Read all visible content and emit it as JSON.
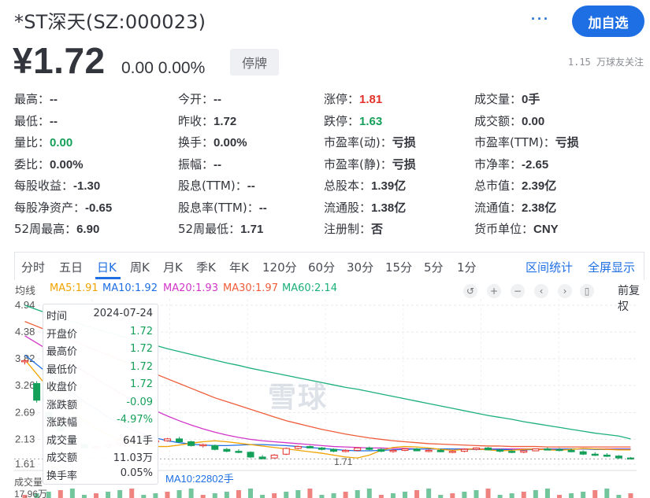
{
  "header": {
    "title": "*ST深天(SZ:000023)",
    "more_label": "···",
    "add_button": "加自选",
    "price": "¥1.72",
    "change": "0.00  0.00%",
    "status_badge": "停牌",
    "followers": "1.15 万球友关注"
  },
  "quote": {
    "rows": [
      [
        {
          "label": "最高：",
          "value": "--"
        },
        {
          "label": "今开：",
          "value": "--"
        },
        {
          "label": "涨停：",
          "value": "1.81",
          "color": "red"
        },
        {
          "label": "成交量：",
          "value": "0手"
        }
      ],
      [
        {
          "label": "最低：",
          "value": "--"
        },
        {
          "label": "昨收：",
          "value": "1.72"
        },
        {
          "label": "跌停：",
          "value": "1.63",
          "color": "green"
        },
        {
          "label": "成交额：",
          "value": "0.00"
        }
      ],
      [
        {
          "label": "量比：",
          "value": "0.00",
          "color": "green"
        },
        {
          "label": "换手：",
          "value": "0.00%"
        },
        {
          "label": "市盈率(动)：",
          "value": "亏损"
        },
        {
          "label": "市盈率(TTM)：",
          "value": "亏损"
        }
      ],
      [
        {
          "label": "委比：",
          "value": "0.00%"
        },
        {
          "label": "振幅：",
          "value": "--"
        },
        {
          "label": "市盈率(静)：",
          "value": "亏损"
        },
        {
          "label": "市净率：",
          "value": "-2.65"
        }
      ],
      [
        {
          "label": "每股收益：",
          "value": "-1.30"
        },
        {
          "label": "股息(TTM)：",
          "value": "--"
        },
        {
          "label": "总股本：",
          "value": "1.39亿"
        },
        {
          "label": "总市值：",
          "value": "2.39亿"
        }
      ],
      [
        {
          "label": "每股净资产：",
          "value": "-0.65"
        },
        {
          "label": "股息率(TTM)：",
          "value": "--"
        },
        {
          "label": "流通股：",
          "value": "1.38亿"
        },
        {
          "label": "流通值：",
          "value": "2.38亿"
        }
      ],
      [
        {
          "label": "52周最高：",
          "value": "6.90"
        },
        {
          "label": "52周最低：",
          "value": "1.71"
        },
        {
          "label": "注册制：",
          "value": "否"
        },
        {
          "label": "货币单位：",
          "value": "CNY"
        }
      ]
    ]
  },
  "tabs": {
    "items": [
      "分时",
      "五日",
      "日K",
      "周K",
      "月K",
      "季K",
      "年K",
      "120分",
      "60分",
      "30分",
      "15分",
      "5分",
      "1分"
    ],
    "active": "日K",
    "range_stats": "区间统计",
    "fullscreen": "全屏显示"
  },
  "ma_bar": {
    "label": "均线",
    "ma5": "MA5:1.91",
    "ma10": "MA10:1.92",
    "ma20": "MA20:1.93",
    "ma30": "MA30:1.97",
    "ma60": "MA60:2.14",
    "adjust": "前复权",
    "colors": {
      "ma5": "#f0a300",
      "ma10": "#1e6fe3",
      "ma20": "#d236c8",
      "ma30": "#ef5d3a",
      "ma60": "#1bb07a"
    }
  },
  "chart_data": {
    "type": "candlestick",
    "y_ticks": [
      "4.94",
      "4.38",
      "3.82",
      "3.26",
      "2.69",
      "2.13",
      "1.61"
    ],
    "ylim": [
      1.61,
      4.94
    ],
    "min_marker": "1.71",
    "ma60": [
      4.94,
      4.85,
      4.76,
      4.68,
      4.6,
      4.52,
      4.44,
      4.37,
      4.3,
      4.23,
      4.16,
      4.1,
      4.03,
      3.97,
      3.91,
      3.85,
      3.79,
      3.73,
      3.68,
      3.62,
      3.57,
      3.52,
      3.47,
      3.42,
      3.37,
      3.32,
      3.27,
      3.22,
      3.18,
      3.13,
      3.08,
      3.03,
      2.98,
      2.93,
      2.88,
      2.83,
      2.78,
      2.73,
      2.68,
      2.63,
      2.59,
      2.55,
      2.5,
      2.46,
      2.42,
      2.38,
      2.34,
      2.3,
      2.26,
      2.23,
      2.2,
      2.14
    ],
    "ma30": [
      4.6,
      4.5,
      4.4,
      4.3,
      4.2,
      4.1,
      4.0,
      3.9,
      3.8,
      3.7,
      3.6,
      3.5,
      3.4,
      3.3,
      3.2,
      3.1,
      3.0,
      2.92,
      2.84,
      2.76,
      2.68,
      2.6,
      2.52,
      2.46,
      2.4,
      2.34,
      2.29,
      2.24,
      2.2,
      2.16,
      2.13,
      2.1,
      2.08,
      2.06,
      2.04,
      2.03,
      2.02,
      2.01,
      2.0,
      1.99,
      1.99,
      1.98,
      1.98,
      1.98,
      1.97,
      1.97,
      1.97,
      1.97,
      1.97,
      1.97,
      1.97,
      1.97
    ],
    "ma20": [
      4.3,
      4.15,
      4.0,
      3.85,
      3.7,
      3.55,
      3.4,
      3.25,
      3.1,
      2.97,
      2.85,
      2.73,
      2.62,
      2.52,
      2.43,
      2.35,
      2.28,
      2.22,
      2.17,
      2.13,
      2.1,
      2.08,
      2.06,
      2.04,
      2.02,
      2.0,
      1.98,
      1.97,
      1.96,
      1.95,
      1.95,
      1.94,
      1.94,
      1.93,
      1.93,
      1.93,
      1.93,
      1.93,
      1.93,
      1.93,
      1.93,
      1.93,
      1.93,
      1.93,
      1.93,
      1.93,
      1.93,
      1.93,
      1.93,
      1.93,
      1.93,
      1.93
    ],
    "ma10": [
      3.9,
      3.7,
      3.5,
      3.3,
      3.1,
      2.92,
      2.76,
      2.6,
      2.46,
      2.34,
      2.24,
      2.16,
      2.1,
      2.06,
      2.03,
      2.01,
      2.0,
      2.0,
      2.01,
      2.02,
      2.02,
      2.01,
      2.0,
      1.98,
      1.96,
      1.94,
      1.92,
      1.9,
      1.89,
      1.89,
      1.9,
      1.91,
      1.92,
      1.93,
      1.93,
      1.93,
      1.93,
      1.92,
      1.92,
      1.92,
      1.92,
      1.91,
      1.91,
      1.92,
      1.92,
      1.92,
      1.93,
      1.93,
      1.92,
      1.92,
      1.92,
      1.92
    ],
    "ma5": [
      3.8,
      3.5,
      3.2,
      2.95,
      2.72,
      2.52,
      2.36,
      2.22,
      2.12,
      2.05,
      2.01,
      1.98,
      1.98,
      2.01,
      2.05,
      2.08,
      2.1,
      2.08,
      2.05,
      2.02,
      1.99,
      1.96,
      1.93,
      1.9,
      1.87,
      1.84,
      1.8,
      1.76,
      1.74,
      1.8,
      1.9,
      1.96,
      1.98,
      1.97,
      1.95,
      1.92,
      1.9,
      1.92,
      1.93,
      1.91,
      1.89,
      1.9,
      1.92,
      1.93,
      1.91,
      1.9,
      1.92,
      1.94,
      1.93,
      1.92,
      1.91,
      1.91
    ],
    "candles": [
      [
        3.76,
        3.8,
        3.7,
        3.78
      ],
      [
        3.3,
        3.35,
        2.9,
        2.95
      ],
      [
        2.7,
        2.75,
        2.5,
        2.55
      ],
      [
        2.42,
        2.46,
        2.25,
        2.3
      ],
      [
        2.2,
        2.24,
        2.05,
        2.1
      ],
      [
        2.02,
        2.05,
        1.92,
        1.95
      ],
      [
        1.96,
        2.0,
        1.93,
        1.98
      ],
      [
        1.97,
        2.03,
        1.95,
        2.02
      ],
      [
        2.03,
        2.15,
        2.02,
        2.12
      ],
      [
        2.12,
        2.2,
        2.1,
        2.18
      ],
      [
        2.16,
        2.2,
        2.08,
        2.1
      ],
      [
        2.08,
        2.12,
        2.04,
        2.1
      ],
      [
        2.1,
        2.16,
        2.08,
        2.14
      ],
      [
        2.14,
        2.18,
        2.06,
        2.08
      ],
      [
        2.08,
        2.1,
        1.98,
        2.0
      ],
      [
        2.0,
        2.04,
        1.96,
        2.02
      ],
      [
        2.0,
        2.02,
        1.9,
        1.92
      ],
      [
        1.92,
        1.95,
        1.86,
        1.88
      ],
      [
        1.88,
        1.92,
        1.84,
        1.86
      ],
      [
        1.86,
        1.88,
        1.74,
        1.76
      ],
      [
        1.76,
        1.8,
        1.71,
        1.72
      ],
      [
        1.74,
        1.82,
        1.73,
        1.8
      ],
      [
        1.82,
        1.96,
        1.8,
        1.94
      ],
      [
        1.94,
        2.0,
        1.92,
        1.98
      ],
      [
        1.98,
        2.0,
        1.94,
        1.95
      ],
      [
        1.95,
        1.97,
        1.9,
        1.92
      ],
      [
        1.92,
        1.94,
        1.86,
        1.88
      ],
      [
        1.88,
        1.92,
        1.86,
        1.9
      ],
      [
        1.9,
        1.96,
        1.88,
        1.95
      ],
      [
        1.95,
        1.98,
        1.9,
        1.92
      ],
      [
        1.92,
        1.94,
        1.86,
        1.88
      ],
      [
        1.88,
        1.92,
        1.85,
        1.9
      ],
      [
        1.9,
        1.94,
        1.88,
        1.93
      ],
      [
        1.93,
        1.95,
        1.88,
        1.89
      ],
      [
        1.89,
        1.92,
        1.86,
        1.9
      ],
      [
        1.9,
        1.93,
        1.86,
        1.87
      ],
      [
        1.87,
        1.9,
        1.84,
        1.88
      ],
      [
        1.88,
        1.94,
        1.86,
        1.92
      ],
      [
        1.92,
        1.96,
        1.9,
        1.95
      ],
      [
        1.95,
        1.97,
        1.9,
        1.91
      ],
      [
        1.91,
        1.93,
        1.86,
        1.88
      ],
      [
        1.88,
        1.9,
        1.84,
        1.86
      ],
      [
        1.86,
        1.9,
        1.84,
        1.89
      ],
      [
        1.89,
        1.94,
        1.88,
        1.93
      ],
      [
        1.93,
        1.96,
        1.9,
        1.92
      ],
      [
        1.92,
        1.95,
        1.88,
        1.9
      ],
      [
        1.9,
        1.93,
        1.86,
        1.87
      ],
      [
        1.87,
        1.9,
        1.8,
        1.82
      ],
      [
        1.82,
        1.86,
        1.78,
        1.8
      ],
      [
        1.8,
        1.84,
        1.76,
        1.78
      ],
      [
        1.78,
        1.8,
        1.72,
        1.74
      ],
      [
        1.74,
        1.76,
        1.71,
        1.72
      ]
    ],
    "volume_axis_label": "成交量",
    "volume_axis_value": "17.96万"
  },
  "tooltip": {
    "rows": [
      {
        "label": "时间",
        "value": "2024-07-24",
        "style": "plain"
      },
      {
        "label": "开盘价",
        "value": "1.72"
      },
      {
        "label": "最高价",
        "value": "1.72"
      },
      {
        "label": "最低价",
        "value": "1.72"
      },
      {
        "label": "收盘价",
        "value": "1.72"
      },
      {
        "label": "涨跌额",
        "value": "-0.09"
      },
      {
        "label": "涨跌幅",
        "value": "-4.97%"
      },
      {
        "label": "成交量",
        "value": "641手",
        "style": "plain"
      },
      {
        "label": "成交额",
        "value": "11.03万",
        "style": "plain"
      },
      {
        "label": "换手率",
        "value": "0.05%",
        "style": "plain"
      }
    ]
  },
  "volume_ma": {
    "ma10": "MA10:22802手"
  },
  "watermark": "雪球"
}
